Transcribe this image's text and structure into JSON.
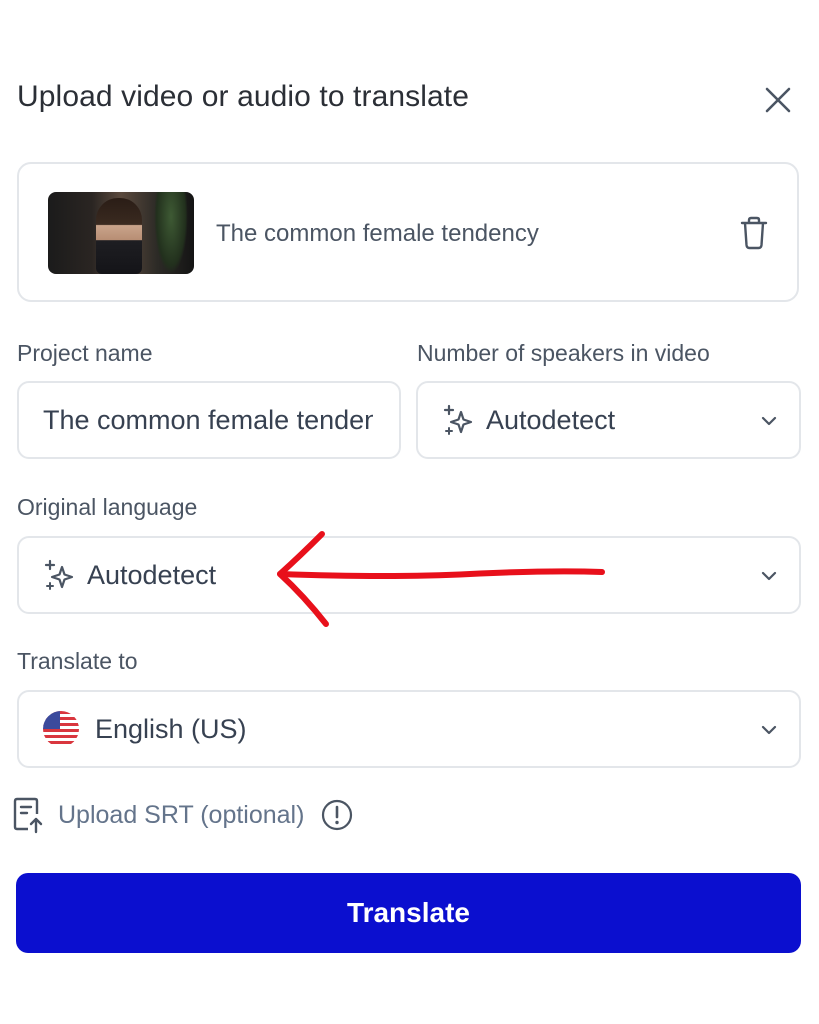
{
  "dialog": {
    "title": "Upload video or audio to translate",
    "close_icon": "close-icon"
  },
  "file": {
    "name": "The common female tendency",
    "delete_icon": "trash-icon"
  },
  "project_name": {
    "label": "Project name",
    "value": "The common female tendency"
  },
  "speakers": {
    "label": "Number of speakers in video",
    "value": "Autodetect",
    "icon": "sparkle-icon"
  },
  "original_language": {
    "label": "Original language",
    "value": "Autodetect",
    "icon": "sparkle-icon"
  },
  "translate_to": {
    "label": "Translate to",
    "value": "English (US)",
    "icon": "us-flag-icon"
  },
  "srt": {
    "label": "Upload SRT (optional)",
    "icon": "file-upload-icon",
    "info_icon": "info-icon"
  },
  "submit": {
    "label": "Translate"
  },
  "colors": {
    "primary_button": "#0b0fcf",
    "annotation_arrow": "#e8101b",
    "border": "#e3e6ea"
  }
}
